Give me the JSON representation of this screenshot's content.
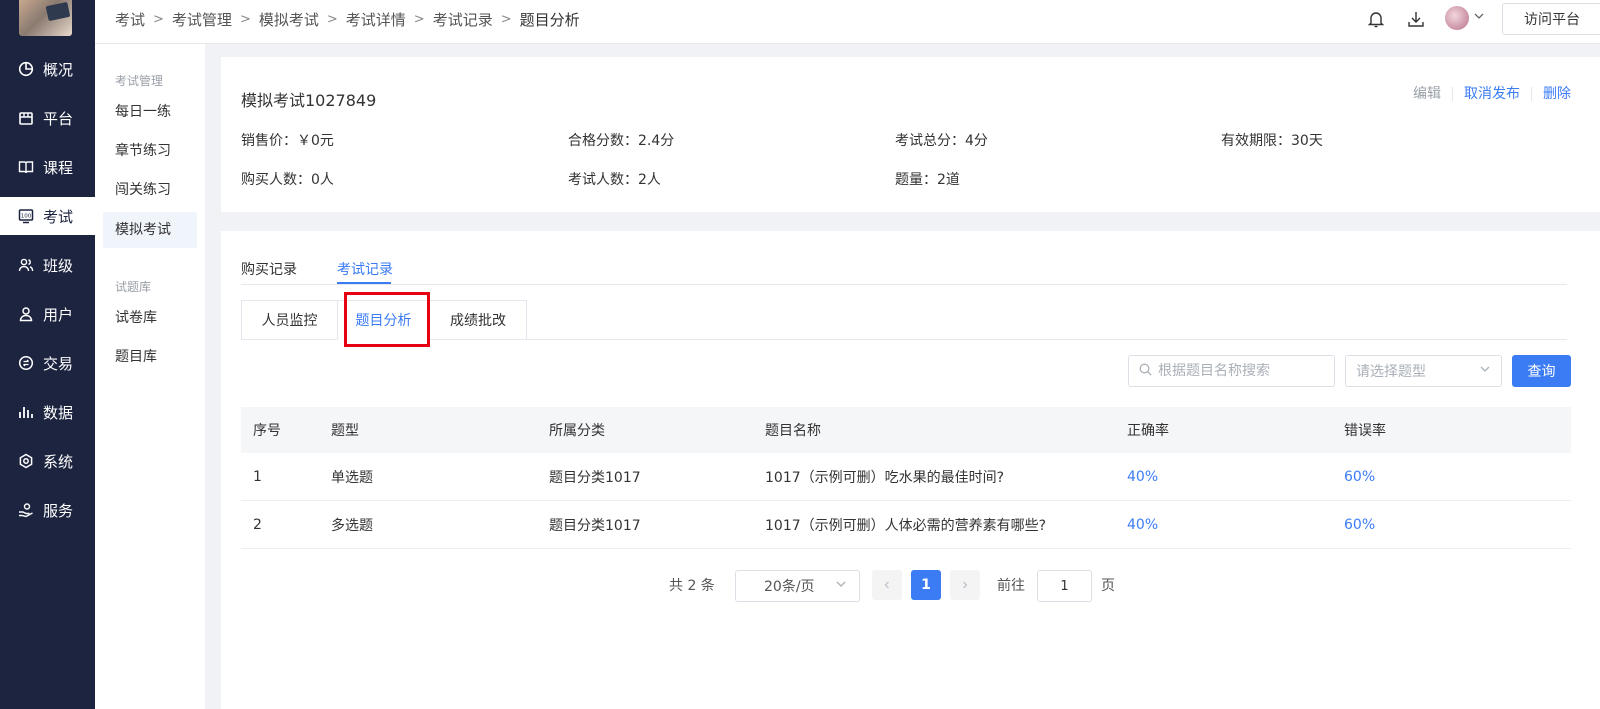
{
  "nav": {
    "items": [
      {
        "label": "概况",
        "icon": "pie-chart-icon"
      },
      {
        "label": "平台",
        "icon": "store-icon"
      },
      {
        "label": "课程",
        "icon": "book-icon"
      },
      {
        "label": "考试",
        "icon": "exam-icon"
      },
      {
        "label": "班级",
        "icon": "users-icon"
      },
      {
        "label": "用户",
        "icon": "user-icon"
      },
      {
        "label": "交易",
        "icon": "transaction-icon"
      },
      {
        "label": "数据",
        "icon": "bar-chart-icon"
      },
      {
        "label": "系统",
        "icon": "gear-icon"
      },
      {
        "label": "服务",
        "icon": "service-icon"
      }
    ],
    "active": "考试"
  },
  "submenu": {
    "group1": "考试管理",
    "group1_items": [
      "每日一练",
      "章节练习",
      "闯关练习",
      "模拟考试"
    ],
    "group2": "试题库",
    "group2_items": [
      "试卷库",
      "题目库"
    ],
    "active": "模拟考试"
  },
  "header": {
    "breadcrumbs": [
      "考试",
      "考试管理",
      "模拟考试",
      "考试详情",
      "考试记录",
      "题目分析"
    ],
    "visit_label": "访问平台"
  },
  "exam": {
    "title": "模拟考试1027849",
    "actions": {
      "edit": "编辑",
      "unpublish": "取消发布",
      "delete": "删除"
    },
    "price": "销售价：￥0元",
    "pass_score": "合格分数：2.4分",
    "total_score": "考试总分：4分",
    "validity": "有效期限：30天",
    "buyers": "购买人数：0人",
    "takers": "考试人数：2人",
    "question_count": "题量：2道"
  },
  "records": {
    "tabs": [
      "购买记录",
      "考试记录"
    ],
    "active_tab": "考试记录",
    "subtabs": [
      "人员监控",
      "题目分析",
      "成绩批改"
    ],
    "active_subtab": "题目分析",
    "search_placeholder": "根据题目名称搜索",
    "type_placeholder": "请选择题型",
    "query_label": "查询",
    "columns": [
      "序号",
      "题型",
      "所属分类",
      "题目名称",
      "正确率",
      "错误率"
    ],
    "rows": [
      {
        "no": "1",
        "type": "单选题",
        "category": "题目分类1017",
        "name": "1017（示例可删）吃水果的最佳时间?",
        "correct": "40%",
        "wrong": "60%"
      },
      {
        "no": "2",
        "type": "多选题",
        "category": "题目分类1017",
        "name": "1017（示例可删）人体必需的营养素有哪些?",
        "correct": "40%",
        "wrong": "60%"
      }
    ],
    "pagination": {
      "total": "共 2 条",
      "page_size": "20条/页",
      "current_page": "1",
      "goto_label": "前往",
      "goto_value": "1",
      "page_suffix": "页"
    }
  },
  "colors": {
    "accent": "#3b7cf5",
    "nav_bg": "#1c2440",
    "highlight": "#e60012"
  }
}
